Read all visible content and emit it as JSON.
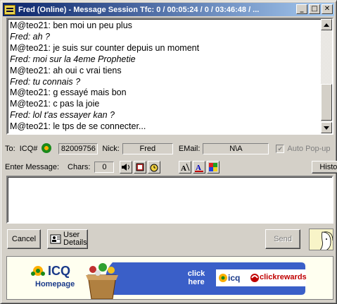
{
  "window": {
    "title": "Fred (Online) - Message Session Tfc: 0 / 00:05:24 / 0 / 03:46:48 / ...",
    "minimize_label": "_",
    "maximize_label": "□",
    "close_label": "✕"
  },
  "chat": {
    "lines": [
      {
        "sender": "M@teo21",
        "text": "M@teo21: ben moi un peu plus",
        "from": "me"
      },
      {
        "sender": "Fred",
        "text": "Fred: ah ?",
        "from": "them"
      },
      {
        "sender": "M@teo21",
        "text": "M@teo21: je suis sur counter depuis un moment",
        "from": "me"
      },
      {
        "sender": "Fred",
        "text": "Fred: moi sur la 4eme Prophetie",
        "from": "them"
      },
      {
        "sender": "M@teo21",
        "text": "M@teo21: ah oui c vrai tiens",
        "from": "me"
      },
      {
        "sender": "Fred",
        "text": "Fred: tu connais ?",
        "from": "them"
      },
      {
        "sender": "M@teo21",
        "text": "M@teo21: g essayé mais bon",
        "from": "me"
      },
      {
        "sender": "M@teo21",
        "text": "M@teo21: c pas la joie",
        "from": "me"
      },
      {
        "sender": "Fred",
        "text": "Fred: lol t'as essayer kan ?",
        "from": "them"
      },
      {
        "sender": "M@teo21",
        "text": "M@teo21: le tps de se connecter...",
        "from": "me"
      }
    ]
  },
  "info": {
    "to_label": "To:",
    "icq_label": "ICQ#",
    "icq_number": "82009756",
    "nick_label": "Nick:",
    "nick_value": "Fred",
    "email_label": "EMail:",
    "email_value": "N\\A",
    "auto_popup_label": "Auto Pop-up",
    "auto_popup_checked": true
  },
  "compose": {
    "enter_message_label": "Enter Message:",
    "chars_label": "Chars:",
    "chars_value": "0",
    "history_label": "History",
    "message_value": ""
  },
  "actions": {
    "cancel_label": "Cancel",
    "user_details_line1": "User",
    "user_details_line2": "Details",
    "send_label": "Send"
  },
  "banner": {
    "icq_logo": "ICQ",
    "homepage_label": "Homepage",
    "click_here_line1": "click",
    "click_here_line2": "here",
    "icq_small_logo": "icq",
    "clickrewards_label": "clickrewards"
  },
  "colors": {
    "titlebar_start": "#0a246a",
    "titlebar_end": "#a6caf0",
    "banner_blue": "#3a5fc8",
    "clickrewards_red": "#c00000",
    "icq_green": "#1a8a1a"
  }
}
